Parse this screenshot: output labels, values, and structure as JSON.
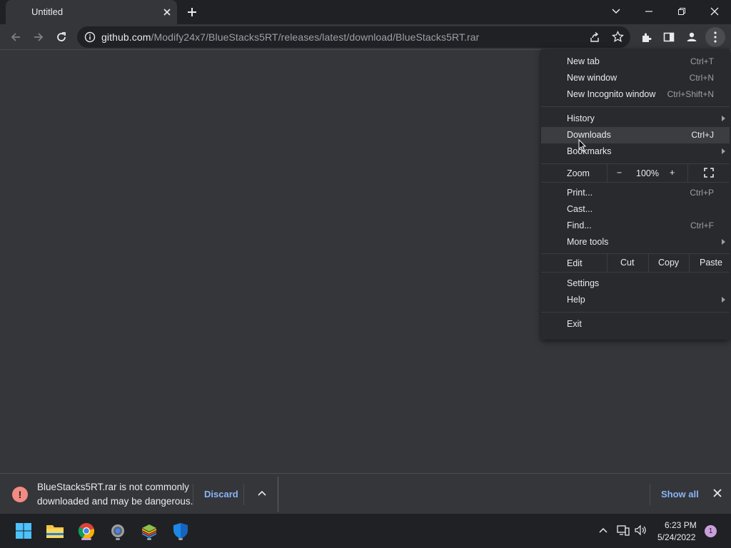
{
  "tab": {
    "title": "Untitled"
  },
  "address_bar": {
    "url_host": "github.com",
    "url_path": "/Modify24x7/BlueStacks5RT/releases/latest/download/BlueStacks5RT.rar"
  },
  "menu": {
    "items_group1": [
      {
        "label": "New tab",
        "shortcut": "Ctrl+T"
      },
      {
        "label": "New window",
        "shortcut": "Ctrl+N"
      },
      {
        "label": "New Incognito window",
        "shortcut": "Ctrl+Shift+N"
      }
    ],
    "history": {
      "label": "History"
    },
    "downloads": {
      "label": "Downloads",
      "shortcut": "Ctrl+J"
    },
    "bookmarks": {
      "label": "Bookmarks"
    },
    "zoom": {
      "label": "Zoom",
      "minus": "−",
      "value": "100%",
      "plus": "+"
    },
    "items_group3": [
      {
        "label": "Print...",
        "shortcut": "Ctrl+P"
      },
      {
        "label": "Cast...",
        "shortcut": ""
      },
      {
        "label": "Find...",
        "shortcut": "Ctrl+F"
      }
    ],
    "more_tools": {
      "label": "More tools"
    },
    "edit": {
      "label": "Edit",
      "cut": "Cut",
      "copy": "Copy",
      "paste": "Paste"
    },
    "settings": {
      "label": "Settings"
    },
    "help": {
      "label": "Help"
    },
    "exit": {
      "label": "Exit"
    }
  },
  "download_bar": {
    "warning_line1": "BlueStacks5RT.rar is not commonly",
    "warning_line2": "downloaded and may be dangerous.",
    "discard_label": "Discard",
    "show_all_label": "Show all",
    "warning_color": "#f28b82",
    "link_color": "#8ab4f8"
  },
  "taskbar": {
    "apps": [
      "windows-start-icon",
      "file-explorer-icon",
      "chrome-icon",
      "settings-gear-icon",
      "bluestacks-icon",
      "windows-security-icon"
    ],
    "time": "6:23 PM",
    "date": "5/24/2022",
    "notification_count": "1"
  }
}
